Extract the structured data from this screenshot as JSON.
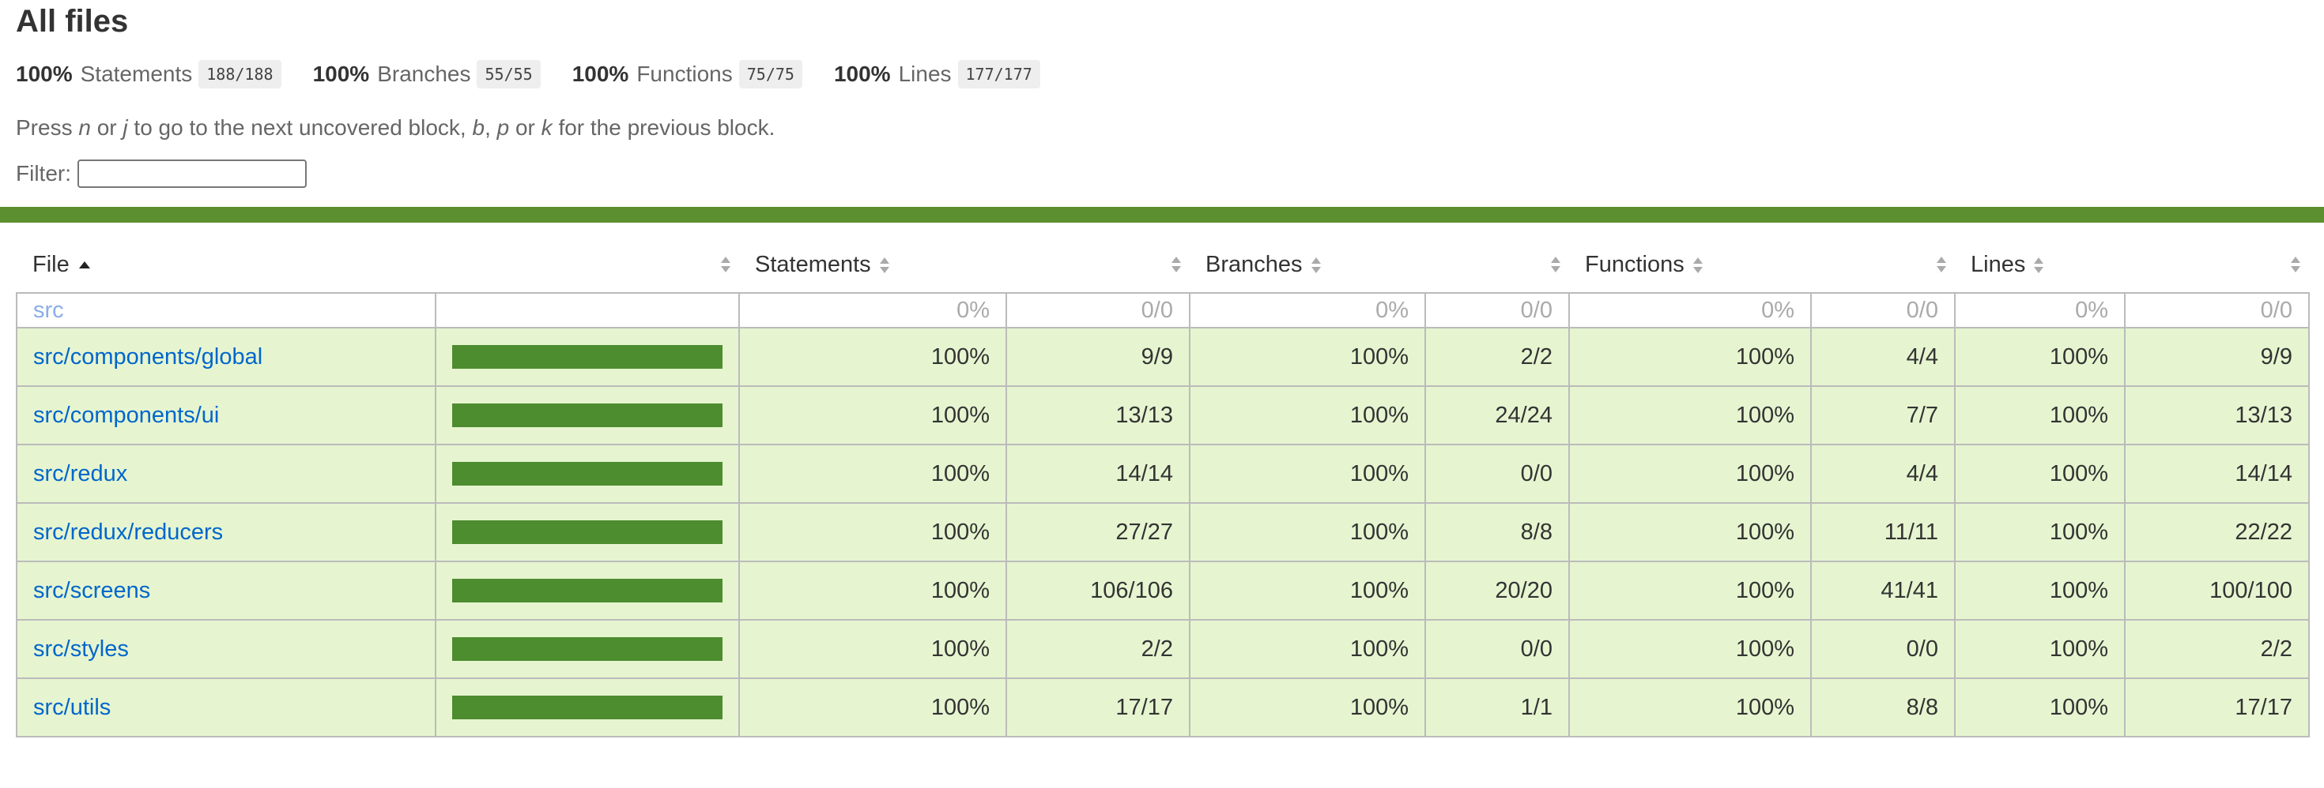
{
  "title": "All files",
  "summary": [
    {
      "pct": "100%",
      "label": "Statements",
      "frac": "188/188"
    },
    {
      "pct": "100%",
      "label": "Branches",
      "frac": "55/55"
    },
    {
      "pct": "100%",
      "label": "Functions",
      "frac": "75/75"
    },
    {
      "pct": "100%",
      "label": "Lines",
      "frac": "177/177"
    }
  ],
  "hint": {
    "p1": "Press ",
    "k1": "n",
    "p2": " or ",
    "k2": "j",
    "p3": " to go to the next uncovered block, ",
    "k3": "b",
    "p4": ", ",
    "k4": "p",
    "p5": " or ",
    "k5": "k",
    "p6": " for the previous block."
  },
  "filter": {
    "label": "Filter:",
    "value": ""
  },
  "status_color": "#5c8f2f",
  "columns": {
    "file": "File",
    "statements": "Statements",
    "branches": "Branches",
    "functions": "Functions",
    "lines": "Lines"
  },
  "rows": [
    {
      "file": "src",
      "coverage": 0,
      "stmt_pct": "0%",
      "stmt": "0/0",
      "br_pct": "0%",
      "br": "0/0",
      "fn_pct": "0%",
      "fn": "0/0",
      "ln_pct": "0%",
      "ln": "0/0"
    },
    {
      "file": "src/components/global",
      "coverage": 1,
      "stmt_pct": "100%",
      "stmt": "9/9",
      "br_pct": "100%",
      "br": "2/2",
      "fn_pct": "100%",
      "fn": "4/4",
      "ln_pct": "100%",
      "ln": "9/9"
    },
    {
      "file": "src/components/ui",
      "coverage": 1,
      "stmt_pct": "100%",
      "stmt": "13/13",
      "br_pct": "100%",
      "br": "24/24",
      "fn_pct": "100%",
      "fn": "7/7",
      "ln_pct": "100%",
      "ln": "13/13"
    },
    {
      "file": "src/redux",
      "coverage": 1,
      "stmt_pct": "100%",
      "stmt": "14/14",
      "br_pct": "100%",
      "br": "0/0",
      "fn_pct": "100%",
      "fn": "4/4",
      "ln_pct": "100%",
      "ln": "14/14"
    },
    {
      "file": "src/redux/reducers",
      "coverage": 1,
      "stmt_pct": "100%",
      "stmt": "27/27",
      "br_pct": "100%",
      "br": "8/8",
      "fn_pct": "100%",
      "fn": "11/11",
      "ln_pct": "100%",
      "ln": "22/22"
    },
    {
      "file": "src/screens",
      "coverage": 1,
      "stmt_pct": "100%",
      "stmt": "106/106",
      "br_pct": "100%",
      "br": "20/20",
      "fn_pct": "100%",
      "fn": "41/41",
      "ln_pct": "100%",
      "ln": "100/100"
    },
    {
      "file": "src/styles",
      "coverage": 1,
      "stmt_pct": "100%",
      "stmt": "2/2",
      "br_pct": "100%",
      "br": "0/0",
      "fn_pct": "100%",
      "fn": "0/0",
      "ln_pct": "100%",
      "ln": "2/2"
    },
    {
      "file": "src/utils",
      "coverage": 1,
      "stmt_pct": "100%",
      "stmt": "17/17",
      "br_pct": "100%",
      "br": "1/1",
      "fn_pct": "100%",
      "fn": "8/8",
      "ln_pct": "100%",
      "ln": "17/17"
    }
  ]
}
